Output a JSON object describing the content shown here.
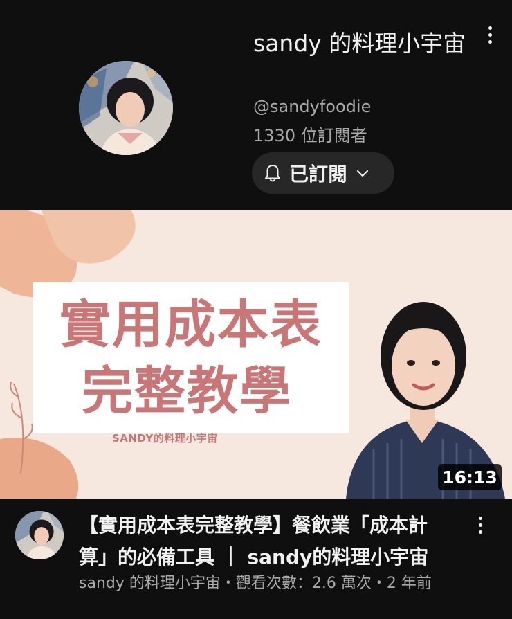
{
  "channel": {
    "name": "sandy 的料理小宇宙",
    "handle": "@sandyfoodie",
    "subscribers": "1330 位訂閱者",
    "subscribe_state": "已訂閱",
    "more_icon": "more-vert-icon",
    "bell_icon": "bell-icon"
  },
  "video": {
    "thumbnail_title_line1": "實用成本表",
    "thumbnail_title_line2": "完整教學",
    "thumbnail_brand": "SANDY的料理小宇宙",
    "duration": "16:13",
    "title": "【實用成本表完整教學】餐飲業「成本計算」的必備工具 ｜ sandy的料理小宇宙",
    "meta": "sandy 的料理小宇宙・觀看次數：2.6 萬次・2 年前"
  },
  "colors": {
    "background": "#0f0f0f",
    "button_bg": "#272727",
    "secondary_text": "#aaaaaa",
    "thumbnail_text": "#c97677",
    "thumbnail_bg": "#f5e6dc"
  }
}
